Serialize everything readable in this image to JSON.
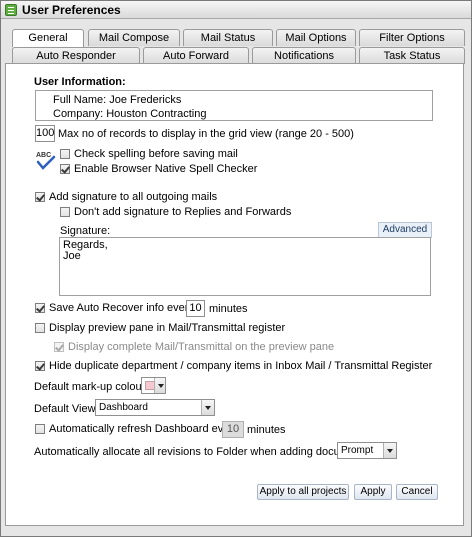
{
  "window": {
    "title": "User Preferences"
  },
  "tabs_row1": [
    {
      "label": "General",
      "active": true
    },
    {
      "label": "Mail Compose"
    },
    {
      "label": "Mail Status"
    },
    {
      "label": "Mail Options"
    },
    {
      "label": "Filter Options"
    }
  ],
  "tabs_row2": [
    {
      "label": "Auto Responder"
    },
    {
      "label": "Auto Forward"
    },
    {
      "label": "Notifications"
    },
    {
      "label": "Task Status"
    }
  ],
  "user_info": {
    "heading": "User Information:",
    "full_name": "Full Name: Joe Fredericks",
    "company": "Company:  Houston Contracting"
  },
  "grid_records": {
    "value": "100",
    "label": "Max no of records to display in the grid view (range 20 - 500)"
  },
  "spelling": {
    "check_before_save": {
      "label": "Check spelling before saving mail",
      "checked": false
    },
    "browser_native": {
      "label": "Enable Browser Native Spell Checker",
      "checked": true
    },
    "icon": "abc-spellcheck-icon"
  },
  "signature": {
    "add_to_all": {
      "label": "Add signature to all outgoing mails",
      "checked": true
    },
    "skip_replies": {
      "label": "Don't add signature to Replies and Forwards",
      "checked": false
    },
    "label": "Signature:",
    "advanced_label": "Advanced",
    "text": "Regards,\nJoe"
  },
  "auto_recover": {
    "label_before": "Save Auto Recover info every",
    "value": "10",
    "label_after": "minutes",
    "checked": true
  },
  "preview_pane": {
    "display": {
      "label": "Display preview pane in Mail/Transmittal register",
      "checked": false
    },
    "complete": {
      "label": "Display complete Mail/Transmittal on the preview pane",
      "checked": true,
      "disabled": true
    }
  },
  "hide_duplicates": {
    "label": "Hide duplicate department / company items in Inbox Mail / Transmittal Register",
    "checked": true
  },
  "markup_colour": {
    "label": "Default mark-up colour:",
    "color": "#f6c9d1"
  },
  "default_view": {
    "label": "Default View:",
    "value": "Dashboard"
  },
  "dashboard_refresh": {
    "label_before": "Automatically refresh Dashboard every",
    "value": "10",
    "label_after": "minutes",
    "checked": false
  },
  "allocate_revisions": {
    "label": "Automatically allocate all revisions to Folder when adding documents:",
    "value": "Prompt"
  },
  "buttons": {
    "apply_all": "Apply to all projects",
    "apply": "Apply",
    "cancel": "Cancel"
  }
}
